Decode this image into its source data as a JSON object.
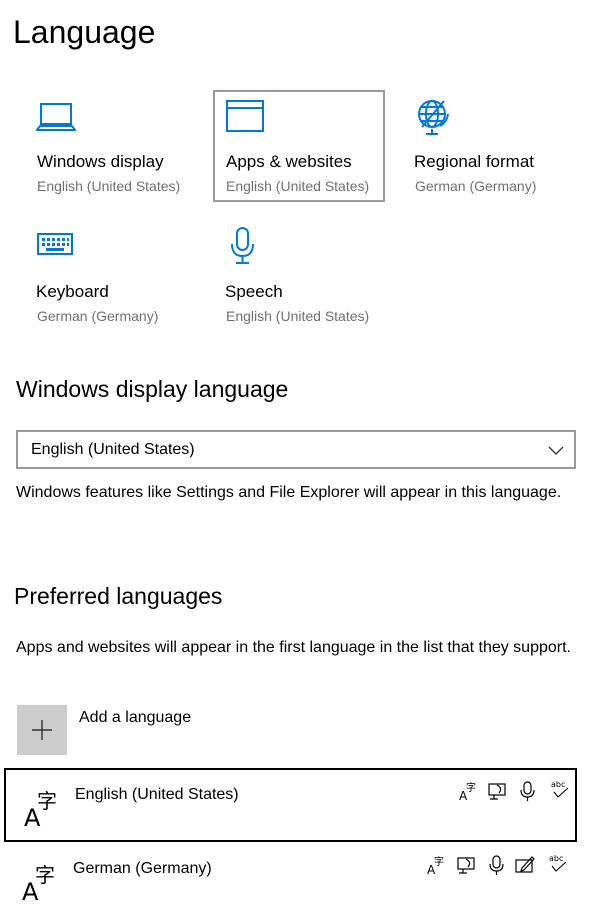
{
  "page": {
    "title": "Language"
  },
  "tiles": [
    {
      "icon": "laptop-icon",
      "title": "Windows display",
      "subtitle": "English (United States)"
    },
    {
      "icon": "browser-window-icon",
      "title": "Apps & websites",
      "subtitle": "English (United States)"
    },
    {
      "icon": "globe-icon",
      "title": "Regional format",
      "subtitle": "German (Germany)"
    },
    {
      "icon": "keyboard-icon",
      "title": "Keyboard",
      "subtitle": "German (Germany)"
    },
    {
      "icon": "microphone-icon",
      "title": "Speech",
      "subtitle": "English (United States)"
    }
  ],
  "display_language": {
    "heading": "Windows display language",
    "selected": "English (United States)",
    "description": "Windows features like Settings and File Explorer will appear in this language."
  },
  "preferred": {
    "heading": "Preferred languages",
    "description": "Apps and websites will appear in the first language in the list that they support.",
    "add_label": "Add a language",
    "languages": [
      {
        "name": "English (United States)",
        "features": [
          "language-pack-icon",
          "text-to-speech-icon",
          "speech-recognition-icon",
          "spell-check-icon"
        ]
      },
      {
        "name": "German (Germany)",
        "features": [
          "language-pack-icon",
          "text-to-speech-icon",
          "speech-recognition-icon",
          "handwriting-icon",
          "spell-check-icon"
        ]
      }
    ]
  },
  "colors": {
    "accent": "#0078d7",
    "selection_border": "#9a9a9a",
    "add_button_bg": "#cccccc"
  }
}
